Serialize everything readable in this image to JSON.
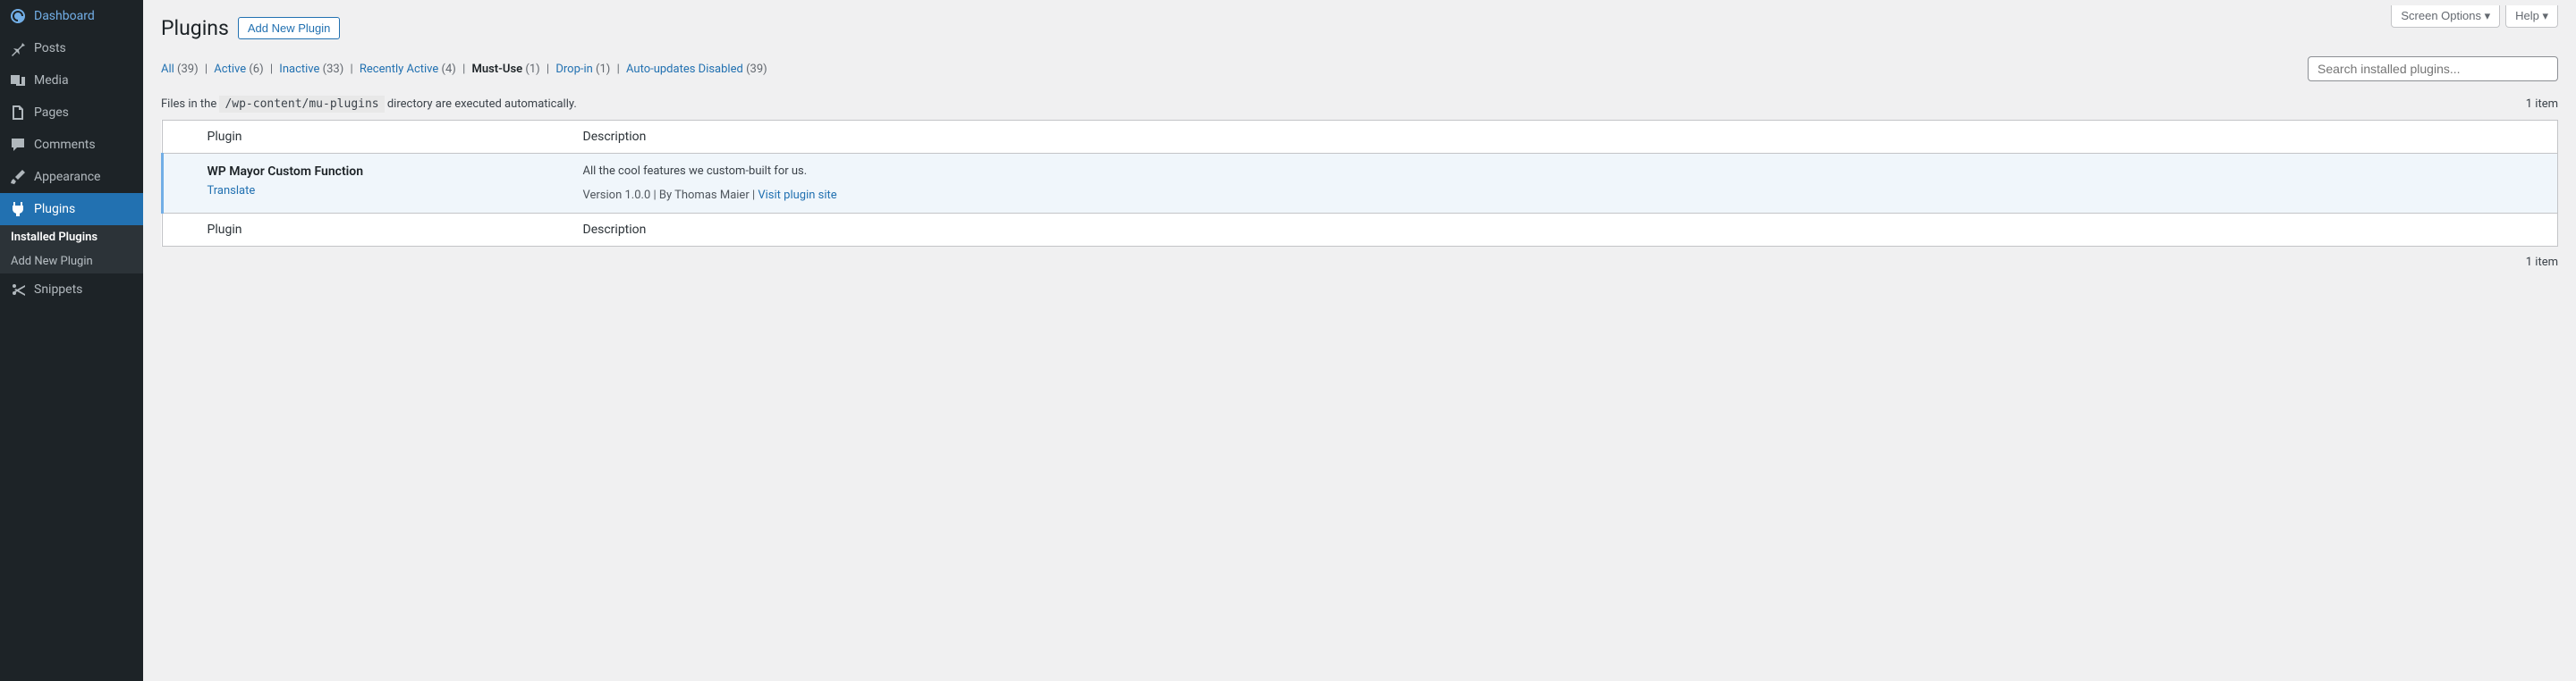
{
  "topButtons": {
    "screenOptions": "Screen Options",
    "help": "Help"
  },
  "sidebar": {
    "dashboard": "Dashboard",
    "posts": "Posts",
    "media": "Media",
    "pages": "Pages",
    "comments": "Comments",
    "appearance": "Appearance",
    "plugins": "Plugins",
    "snippets": "Snippets",
    "submenu": {
      "installed": "Installed Plugins",
      "addNew": "Add New Plugin"
    }
  },
  "page": {
    "title": "Plugins",
    "addNewBtn": "Add New Plugin"
  },
  "filters": {
    "all": {
      "label": "All",
      "count": "(39)"
    },
    "active": {
      "label": "Active",
      "count": "(6)"
    },
    "inactive": {
      "label": "Inactive",
      "count": "(33)"
    },
    "recentlyActive": {
      "label": "Recently Active",
      "count": "(4)"
    },
    "mustUse": {
      "label": "Must-Use",
      "count": "(1)"
    },
    "dropIn": {
      "label": "Drop-in",
      "count": "(1)"
    },
    "autoUpdatesDisabled": {
      "label": "Auto-updates Disabled",
      "count": "(39)"
    }
  },
  "search": {
    "placeholder": "Search installed plugins..."
  },
  "infoLine": {
    "prefix": "Files in the ",
    "code": "/wp-content/mu-plugins",
    "suffix": " directory are executed automatically."
  },
  "itemCount": "1 item",
  "table": {
    "colPlugin": "Plugin",
    "colDescription": "Description"
  },
  "plugin": {
    "name": "WP Mayor Custom Function",
    "translate": "Translate",
    "description": "All the cool features we custom-built for us.",
    "metaPrefix": "Version 1.0.0 | By Thomas Maier | ",
    "visitLink": "Visit plugin site"
  }
}
